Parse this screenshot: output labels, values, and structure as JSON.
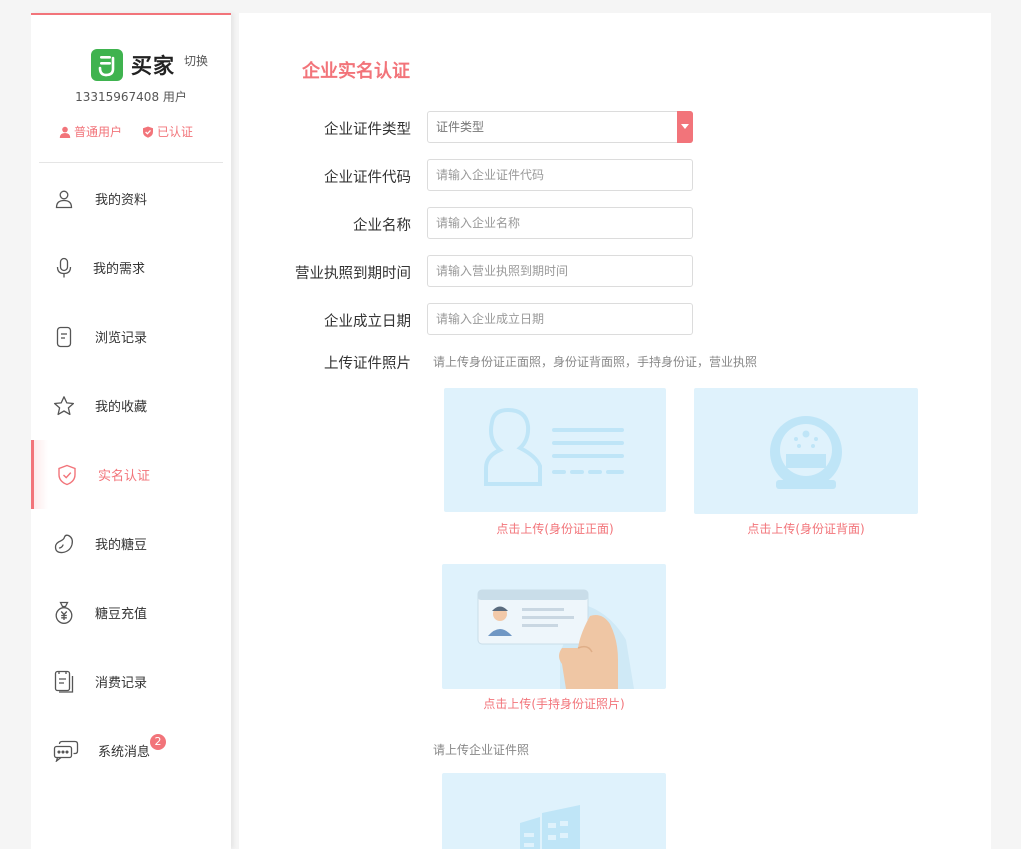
{
  "sidebar": {
    "brand_name": "买家",
    "switch_label": "切换",
    "account": "13315967408 用户",
    "badge_user": "普通用户",
    "badge_verified": "已认证",
    "items": [
      {
        "label": "我的资料",
        "icon": "user-icon"
      },
      {
        "label": "我的需求",
        "icon": "microphone-icon"
      },
      {
        "label": "浏览记录",
        "icon": "history-icon"
      },
      {
        "label": "我的收藏",
        "icon": "star-icon"
      },
      {
        "label": "实名认证",
        "icon": "shield-check-icon",
        "active": true
      },
      {
        "label": "我的糖豆",
        "icon": "bean-icon"
      },
      {
        "label": "糖豆充值",
        "icon": "money-bag-icon"
      },
      {
        "label": "消费记录",
        "icon": "receipt-icon"
      },
      {
        "label": "系统消息",
        "icon": "chat-icon",
        "badge": "2"
      }
    ]
  },
  "main": {
    "title": "企业实名认证",
    "fields": {
      "cert_type": {
        "label": "企业证件类型",
        "value": "证件类型"
      },
      "cert_code": {
        "label": "企业证件代码",
        "placeholder": "请输入企业证件代码"
      },
      "company_name": {
        "label": "企业名称",
        "placeholder": "请输入企业名称"
      },
      "license_expiry": {
        "label": "营业执照到期时间",
        "placeholder": "请输入营业执照到期时间"
      },
      "founding_date": {
        "label": "企业成立日期",
        "placeholder": "请输入企业成立日期"
      }
    },
    "upload": {
      "label": "上传证件照片",
      "hint": "请上传身份证正面照，身份证背面照，手持身份证，营业执照",
      "front_caption": "点击上传(身份证正面)",
      "back_caption": "点击上传(身份证背面)",
      "handheld_caption": "点击上传(手持身份证照片)",
      "company_hint": "请上传企业证件照",
      "card_text": "IDENTITY CARD"
    }
  },
  "colors": {
    "accent": "#f2747a",
    "brand_green": "#3fb34f",
    "upload_bg": "#dff2fc"
  }
}
